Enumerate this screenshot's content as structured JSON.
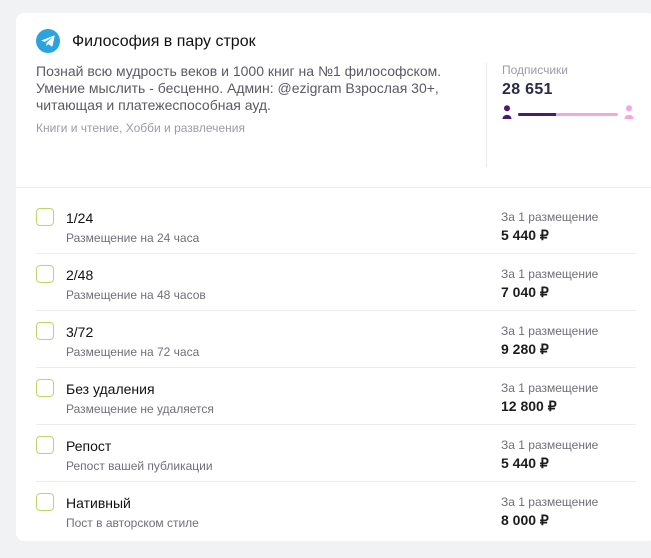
{
  "channel": {
    "title": "Философия в пару строк",
    "description": "Познай всю мудрость веков и 1000 книг на №1 философском. Умение мыслить - бесценно. Админ: @ezigram Взрослая 30+, читающая и платежеспособная ауд.",
    "categories": "Книги и чтение, Хобби и развлечения",
    "icon": "telegram-icon"
  },
  "stats": {
    "subscribers_label": "Подписчики",
    "subscribers_value": "28 651",
    "male_share": 0.38,
    "colors": {
      "male": "#4b1a6f",
      "female": "#f3a6e6"
    }
  },
  "offers": [
    {
      "name": "1/24",
      "subtitle": "Размещение на 24 часа",
      "per_label": "За 1 размещение",
      "price": "5 440 ₽"
    },
    {
      "name": "2/48",
      "subtitle": "Размещение на 48 часов",
      "per_label": "За 1 размещение",
      "price": "7 040 ₽"
    },
    {
      "name": "3/72",
      "subtitle": "Размещение на 72 часа",
      "per_label": "За 1 размещение",
      "price": "9 280 ₽"
    },
    {
      "name": "Без удаления",
      "subtitle": "Размещение не удаляется",
      "per_label": "За 1 размещение",
      "price": "12 800 ₽"
    },
    {
      "name": "Репост",
      "subtitle": "Репост вашей публикации",
      "per_label": "За 1 размещение",
      "price": "5 440 ₽"
    },
    {
      "name": "Нативный",
      "subtitle": "Пост в авторском стиле",
      "per_label": "За 1 размещение",
      "price": "8 000 ₽"
    }
  ],
  "colors": {
    "accent_checkbox": "#b8d96a",
    "telegram": "#2aa3df"
  }
}
